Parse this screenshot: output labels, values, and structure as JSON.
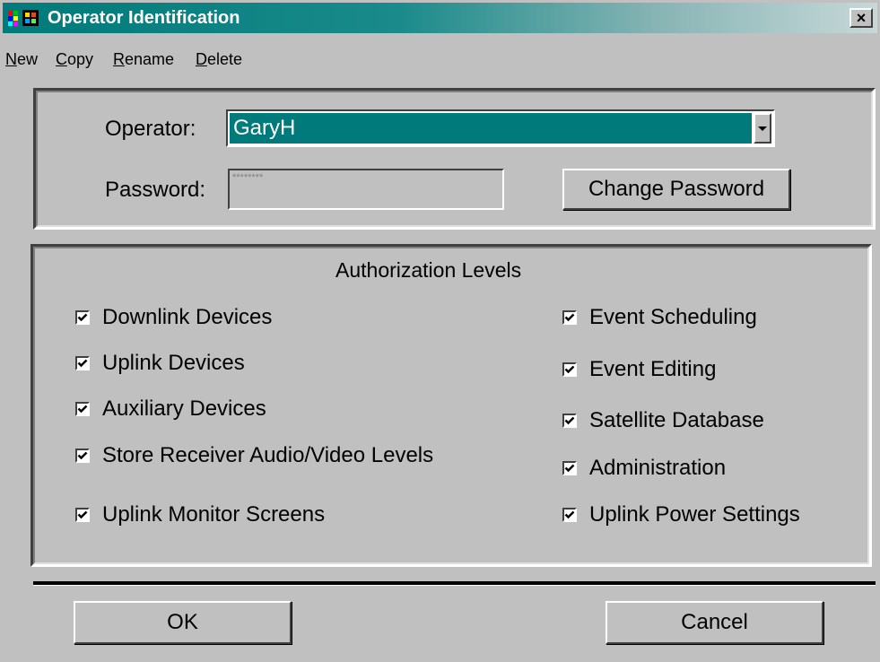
{
  "window": {
    "title": "Operator Identification",
    "icon": "app-window-icon",
    "close_label": "×"
  },
  "menu": {
    "items": [
      {
        "accel": "N",
        "rest": "ew"
      },
      {
        "accel": "C",
        "rest": "opy"
      },
      {
        "accel": "R",
        "rest": "ename"
      },
      {
        "accel": "D",
        "rest": "elete"
      }
    ]
  },
  "operator": {
    "label": "Operator:",
    "value": "GaryH"
  },
  "password": {
    "label": "Password:",
    "value": "********",
    "change_button": "Change Password"
  },
  "authorization": {
    "heading": "Authorization Levels",
    "left": [
      {
        "label": "Downlink Devices",
        "checked": true
      },
      {
        "label": "Uplink Devices",
        "checked": true
      },
      {
        "label": "Auxiliary Devices",
        "checked": true
      },
      {
        "label": "Store Receiver Audio/Video Levels",
        "checked": true
      },
      {
        "label": "Uplink Monitor Screens",
        "checked": true
      }
    ],
    "right": [
      {
        "label": "Event Scheduling",
        "checked": true
      },
      {
        "label": "Event Editing",
        "checked": true
      },
      {
        "label": "Satellite Database",
        "checked": true
      },
      {
        "label": "Administration",
        "checked": true
      },
      {
        "label": "Uplink Power Settings",
        "checked": true
      }
    ]
  },
  "buttons": {
    "ok": "OK",
    "cancel": "Cancel"
  },
  "colors": {
    "accent": "#007a7a",
    "face": "#c0c0c0"
  }
}
